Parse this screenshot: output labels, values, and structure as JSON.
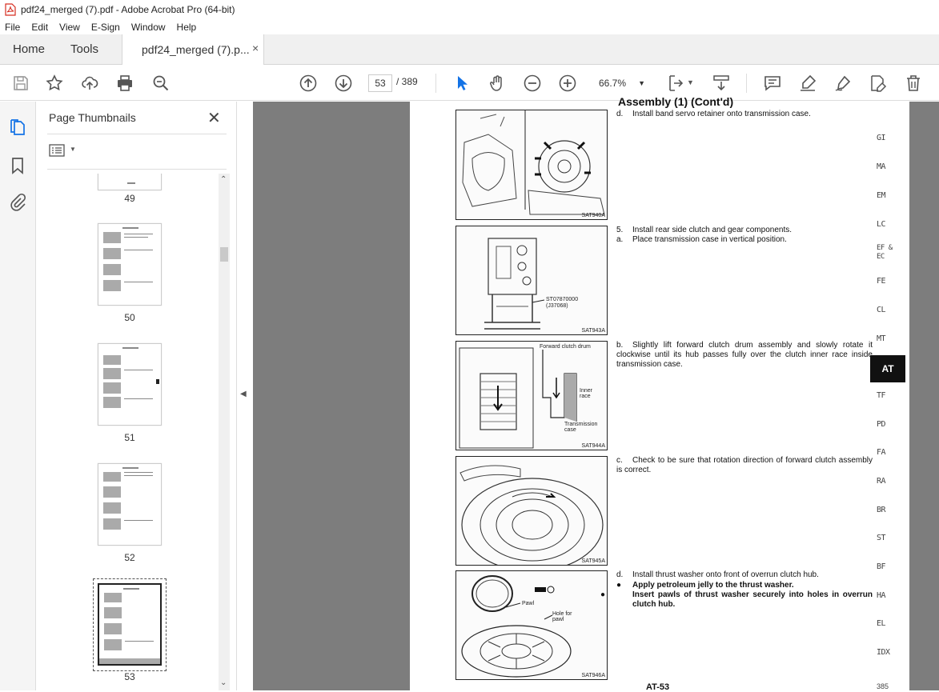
{
  "window": {
    "title": "pdf24_merged (7).pdf - Adobe Acrobat Pro (64-bit)"
  },
  "menu": [
    "File",
    "Edit",
    "View",
    "E-Sign",
    "Window",
    "Help"
  ],
  "tabs": {
    "home": "Home",
    "tools": "Tools",
    "doc": "pdf24_merged (7).p...",
    "close": "×"
  },
  "toolbar": {
    "page_current": "53",
    "page_total": "/ 389",
    "zoom": "66.7%"
  },
  "panel": {
    "title": "Page Thumbnails",
    "close": "✕",
    "thumb_numbers": [
      "49",
      "50",
      "51",
      "52",
      "53"
    ]
  },
  "doc": {
    "header": "Assembly (1) (Cont'd)",
    "steps": [
      {
        "id": "d1",
        "label": "d.",
        "text": "Install band servo retainer onto transmission case."
      },
      {
        "id": "5",
        "label": "5.",
        "text": "Install rear side clutch and gear components."
      },
      {
        "id": "a",
        "label": "a.",
        "text": "Place transmission case in vertical position."
      },
      {
        "id": "b",
        "label": "b.",
        "text": "Slightly lift forward clutch drum assembly and slowly rotate it clockwise until its hub passes fully over the clutch inner race inside transmission case."
      },
      {
        "id": "c",
        "label": "c.",
        "text": "Check to be sure that rotation direction of forward clutch assembly is correct."
      },
      {
        "id": "d2",
        "label": "d.",
        "text": "Install thrust washer onto front of overrun clutch hub."
      },
      {
        "id": "bul1",
        "label": "●",
        "text": "Apply petroleum jelly to the thrust washer."
      },
      {
        "id": "bul2",
        "label": "●",
        "text": "Insert pawls of thrust washer securely into holes in overrun clutch hub."
      }
    ],
    "figures": [
      {
        "code": "SAT940A",
        "labels": []
      },
      {
        "code": "SAT943A",
        "labels": [
          "ST07870000",
          "(J37068)"
        ]
      },
      {
        "code": "SAT944A",
        "labels": [
          "Forward clutch drum",
          "Inner race",
          "Transmission case"
        ]
      },
      {
        "code": "SAT945A",
        "labels": []
      },
      {
        "code": "SAT946A",
        "labels": [
          "Pawl",
          "Hole for pawl"
        ]
      }
    ],
    "section_tabs": [
      "GI",
      "MA",
      "EM",
      "LC",
      "EF & EC",
      "FE",
      "CL",
      "MT",
      "AT",
      "TF",
      "PD",
      "FA",
      "RA",
      "BR",
      "ST",
      "BF",
      "HA",
      "EL",
      "IDX"
    ],
    "active_section": "AT",
    "footer": "AT-53",
    "footer_right": "385"
  },
  "colors": {
    "accent": "#1473e6",
    "doc_bg": "#7d7d7d",
    "active_tab": "#111111"
  }
}
